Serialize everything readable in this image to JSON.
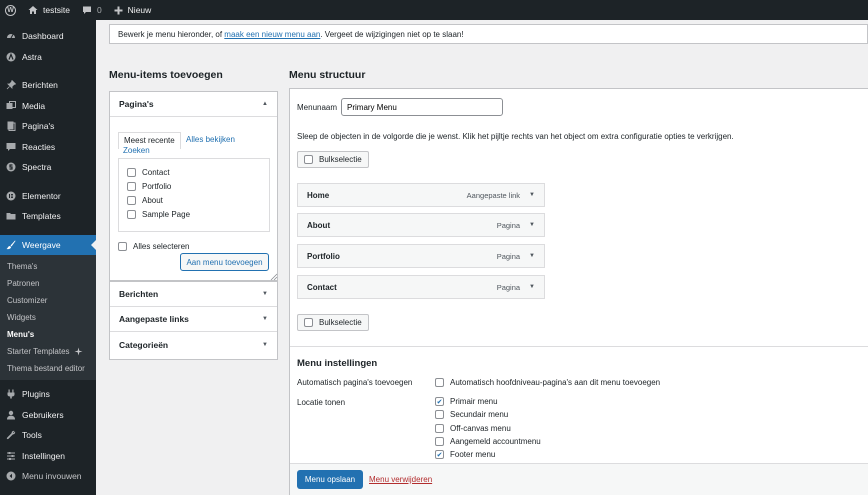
{
  "adminbar": {
    "site_name": "testsite",
    "comments_count": "0",
    "new_label": "Nieuw"
  },
  "sidebar": {
    "items": [
      {
        "label": "Dashboard",
        "icon": "dashboard-icon"
      },
      {
        "label": "Astra",
        "icon": "astra-icon"
      },
      {
        "label": "Berichten",
        "icon": "pin-icon"
      },
      {
        "label": "Media",
        "icon": "media-icon"
      },
      {
        "label": "Pagina's",
        "icon": "page-icon"
      },
      {
        "label": "Reacties",
        "icon": "comment-icon"
      },
      {
        "label": "Spectra",
        "icon": "spectra-icon"
      },
      {
        "label": "Elementor",
        "icon": "elementor-icon"
      },
      {
        "label": "Templates",
        "icon": "folder-icon"
      },
      {
        "label": "Weergave",
        "icon": "brush-icon"
      }
    ],
    "submenu": [
      {
        "label": "Thema's"
      },
      {
        "label": "Patronen"
      },
      {
        "label": "Customizer"
      },
      {
        "label": "Widgets"
      },
      {
        "label": "Menu's"
      },
      {
        "label": "Starter Templates"
      },
      {
        "label": "Thema bestand editor"
      }
    ],
    "items_after": [
      {
        "label": "Plugins",
        "icon": "plugin-icon"
      },
      {
        "label": "Gebruikers",
        "icon": "users-icon"
      },
      {
        "label": "Tools",
        "icon": "wrench-icon"
      },
      {
        "label": "Instellingen",
        "icon": "settings-icon"
      },
      {
        "label": "Menu invouwen",
        "icon": "collapse-icon"
      }
    ]
  },
  "notice": {
    "prefix": "Bewerk je menu hieronder, of ",
    "link": "maak een nieuw menu aan",
    "suffix": ". Vergeet de wijzigingen niet op te slaan!"
  },
  "left": {
    "heading": "Menu-items toevoegen",
    "pages": {
      "title": "Pagina's",
      "tab_recent": "Meest recente",
      "tab_all": "Alles bekijken",
      "tab_search": "Zoeken",
      "items": [
        "Contact",
        "Portfolio",
        "About",
        "Sample Page"
      ],
      "select_all": "Alles selecteren",
      "add_button": "Aan menu toevoegen"
    },
    "sections": [
      "Berichten",
      "Aangepaste links",
      "Categorieën"
    ]
  },
  "right": {
    "heading": "Menu structuur",
    "menu_name_label": "Menunaam",
    "menu_name_value": "Primary Menu",
    "instructions": "Sleep de objecten in de volgorde die je wenst. Klik het pijltje rechts van het object om extra configuratie opties te verkrijgen.",
    "bulk_label": "Bulkselectie",
    "items": [
      {
        "title": "Home",
        "type": "Aangepaste link"
      },
      {
        "title": "About",
        "type": "Pagina"
      },
      {
        "title": "Portfolio",
        "type": "Pagina"
      },
      {
        "title": "Contact",
        "type": "Pagina"
      }
    ],
    "settings": {
      "heading": "Menu instellingen",
      "auto_add_label": "Automatisch pagina's toevoegen",
      "auto_add_option": "Automatisch hoofdniveau-pagina's aan dit menu toevoegen",
      "locations_label": "Locatie tonen",
      "locations": [
        {
          "label": "Primair menu",
          "checked": true
        },
        {
          "label": "Secundair menu",
          "checked": false
        },
        {
          "label": "Off-canvas menu",
          "checked": false
        },
        {
          "label": "Aangemeld accountmenu",
          "checked": false
        },
        {
          "label": "Footer menu",
          "checked": true
        }
      ]
    },
    "save_button": "Menu opslaan",
    "delete_link": "Menu verwijderen"
  },
  "colors": {
    "accent": "#2271b1",
    "admin_dark": "#1d2327",
    "danger": "#b32d2e"
  }
}
